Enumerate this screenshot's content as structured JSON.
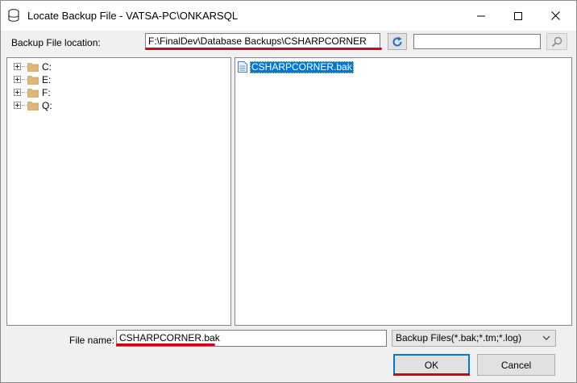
{
  "window": {
    "title": "Locate Backup File - VATSA-PC\\ONKARSQL",
    "icons": [
      "database-icon",
      "minimize-icon",
      "maximize-icon",
      "close-icon"
    ]
  },
  "location": {
    "label": "Backup File location:",
    "value": "F:\\FinalDev\\Database Backups\\CSHARPCORNER",
    "refresh_icon": "refresh-icon",
    "search_value": "",
    "search_icon": "search-icon"
  },
  "tree": {
    "items": [
      {
        "label": "C:",
        "icon": "folder-icon"
      },
      {
        "label": "E:",
        "icon": "folder-icon"
      },
      {
        "label": "F:",
        "icon": "folder-icon"
      },
      {
        "label": "Q:",
        "icon": "folder-icon"
      }
    ]
  },
  "files": {
    "items": [
      {
        "label": "CSHARPCORNER.bak",
        "icon": "file-icon",
        "selected": true
      }
    ]
  },
  "footer": {
    "file_name_label": "File name:",
    "file_name_value": "CSHARPCORNER.bak",
    "filter_selected": "Backup Files(*.bak;*.tm;*.log)",
    "ok_label": "OK",
    "cancel_label": "Cancel"
  },
  "colors": {
    "accent": "#0078d7",
    "highlight_underline": "#d0021b",
    "folder": "#dcb67a"
  }
}
